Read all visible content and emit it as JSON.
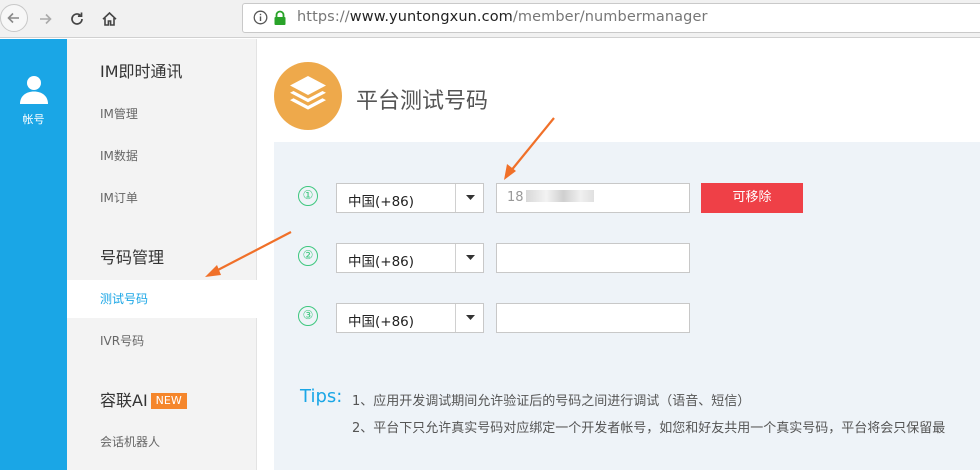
{
  "browser": {
    "url_scheme": "https://",
    "url_host": "www.yuntongxun.com",
    "url_path": "/member/numbermanager"
  },
  "account": {
    "label": "帐号"
  },
  "sidebar": {
    "sections": [
      {
        "title": "IM即时通讯",
        "items": [
          "IM管理",
          "IM数据",
          "IM订单"
        ]
      },
      {
        "title": "号码管理",
        "items": [
          "测试号码",
          "IVR号码"
        ]
      },
      {
        "title": "容联AI",
        "badge": "NEW",
        "items": [
          "会话机器人"
        ]
      }
    ],
    "active_item": "测试号码"
  },
  "main": {
    "title": "平台测试号码",
    "rows": [
      {
        "index": "①",
        "country": "中国(+86)",
        "number_visible": "18",
        "remove_label": "可移除"
      },
      {
        "index": "②",
        "country": "中国(+86)",
        "number_visible": ""
      },
      {
        "index": "③",
        "country": "中国(+86)",
        "number_visible": ""
      }
    ],
    "tips_label": "Tips:",
    "tips": [
      "1、应用开发调试期间允许验证后的号码之间进行调试（语音、短信）",
      "2、平台下只允许真实号码对应绑定一个开发者帐号，如您和好友共用一个真实号码，平台将会只保留最"
    ]
  },
  "colors": {
    "accent_blue": "#1aa6e6",
    "remove_red": "#ef4047",
    "step_green": "#3ec77f",
    "badge_orange": "#f5862b",
    "annotation_orange": "#f07029"
  }
}
